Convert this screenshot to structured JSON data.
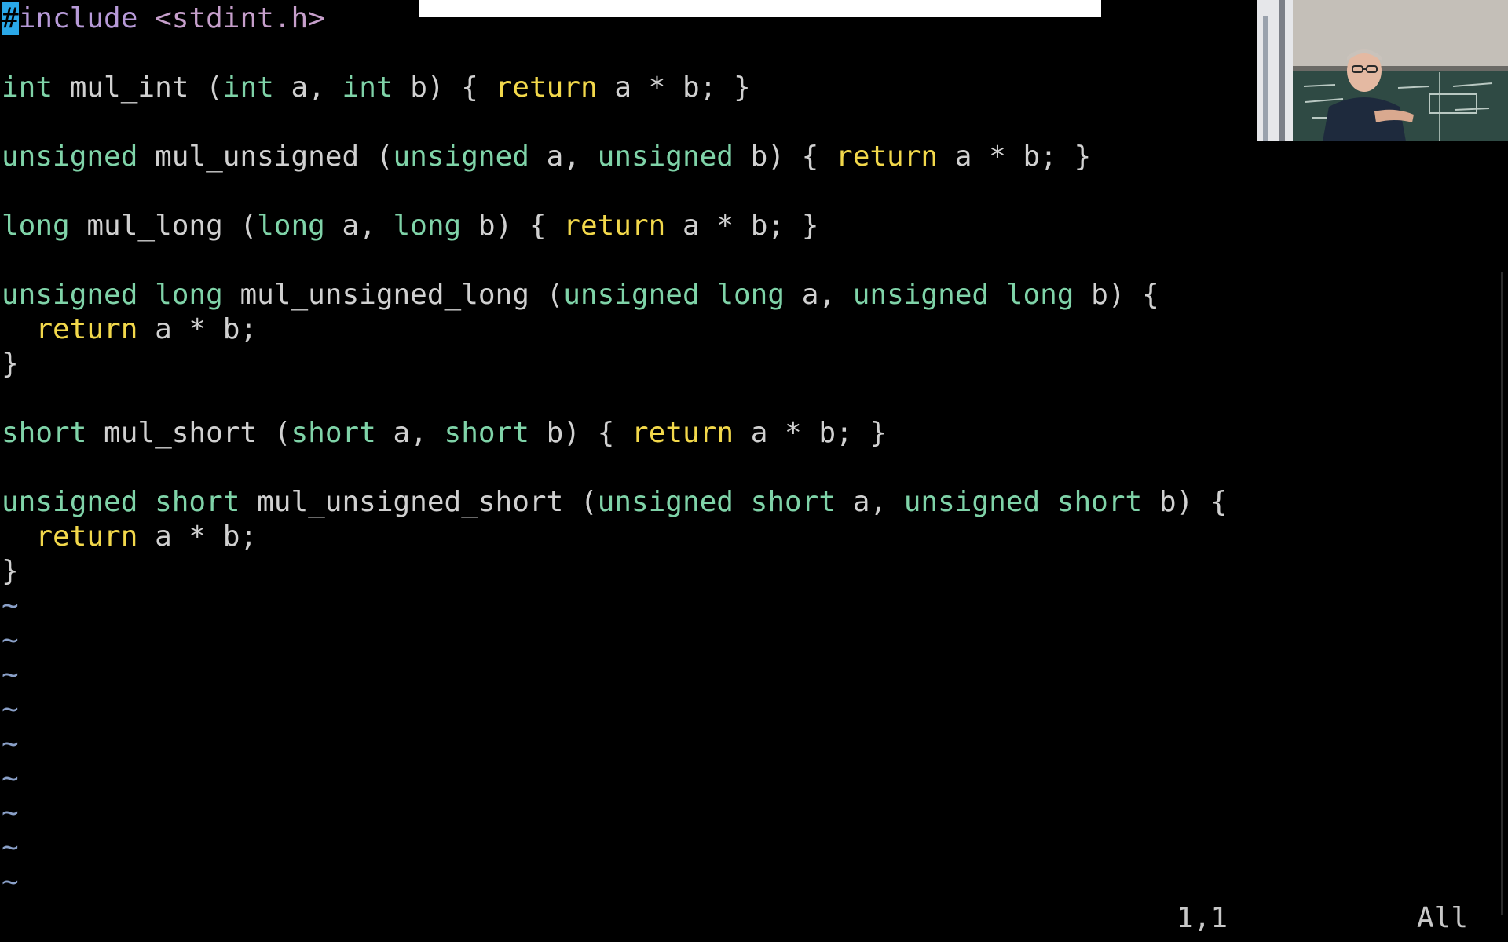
{
  "editor": {
    "lines": [
      [
        {
          "t": "#",
          "c": "cursor-char"
        },
        {
          "t": "include",
          "c": "kw-pre"
        },
        {
          "t": " ",
          "c": "plain"
        },
        {
          "t": "<stdint.h>",
          "c": "inc"
        }
      ],
      [],
      [
        {
          "t": "int",
          "c": "kw-type"
        },
        {
          "t": " mul_int (",
          "c": "plain"
        },
        {
          "t": "int",
          "c": "kw-type"
        },
        {
          "t": " a, ",
          "c": "plain"
        },
        {
          "t": "int",
          "c": "kw-type"
        },
        {
          "t": " b) { ",
          "c": "plain"
        },
        {
          "t": "return",
          "c": "kw-ret"
        },
        {
          "t": " a * b; }",
          "c": "plain"
        }
      ],
      [],
      [
        {
          "t": "unsigned",
          "c": "kw-type"
        },
        {
          "t": " mul_unsigned (",
          "c": "plain"
        },
        {
          "t": "unsigned",
          "c": "kw-type"
        },
        {
          "t": " a, ",
          "c": "plain"
        },
        {
          "t": "unsigned",
          "c": "kw-type"
        },
        {
          "t": " b) { ",
          "c": "plain"
        },
        {
          "t": "return",
          "c": "kw-ret"
        },
        {
          "t": " a * b; }",
          "c": "plain"
        }
      ],
      [],
      [
        {
          "t": "long",
          "c": "kw-type"
        },
        {
          "t": " mul_long (",
          "c": "plain"
        },
        {
          "t": "long",
          "c": "kw-type"
        },
        {
          "t": " a, ",
          "c": "plain"
        },
        {
          "t": "long",
          "c": "kw-type"
        },
        {
          "t": " b) { ",
          "c": "plain"
        },
        {
          "t": "return",
          "c": "kw-ret"
        },
        {
          "t": " a * b; }",
          "c": "plain"
        }
      ],
      [],
      [
        {
          "t": "unsigned long",
          "c": "kw-type"
        },
        {
          "t": " mul_unsigned_long (",
          "c": "plain"
        },
        {
          "t": "unsigned long",
          "c": "kw-type"
        },
        {
          "t": " a, ",
          "c": "plain"
        },
        {
          "t": "unsigned long",
          "c": "kw-type"
        },
        {
          "t": " b) {",
          "c": "plain"
        }
      ],
      [
        {
          "t": "  ",
          "c": "plain"
        },
        {
          "t": "return",
          "c": "kw-ret"
        },
        {
          "t": " a * b;",
          "c": "plain"
        }
      ],
      [
        {
          "t": "}",
          "c": "plain"
        }
      ],
      [],
      [
        {
          "t": "short",
          "c": "kw-type"
        },
        {
          "t": " mul_short (",
          "c": "plain"
        },
        {
          "t": "short",
          "c": "kw-type"
        },
        {
          "t": " a, ",
          "c": "plain"
        },
        {
          "t": "short",
          "c": "kw-type"
        },
        {
          "t": " b) { ",
          "c": "plain"
        },
        {
          "t": "return",
          "c": "kw-ret"
        },
        {
          "t": " a * b; }",
          "c": "plain"
        }
      ],
      [],
      [
        {
          "t": "unsigned short",
          "c": "kw-type"
        },
        {
          "t": " mul_unsigned_short (",
          "c": "plain"
        },
        {
          "t": "unsigned short",
          "c": "kw-type"
        },
        {
          "t": " a, ",
          "c": "plain"
        },
        {
          "t": "unsigned short",
          "c": "kw-type"
        },
        {
          "t": " b) {",
          "c": "plain"
        }
      ],
      [
        {
          "t": "  ",
          "c": "plain"
        },
        {
          "t": "return",
          "c": "kw-ret"
        },
        {
          "t": " a * b;",
          "c": "plain"
        }
      ],
      [
        {
          "t": "}",
          "c": "plain"
        }
      ],
      [
        {
          "t": "~",
          "c": "tilde"
        }
      ],
      [
        {
          "t": "~",
          "c": "tilde"
        }
      ],
      [
        {
          "t": "~",
          "c": "tilde"
        }
      ],
      [
        {
          "t": "~",
          "c": "tilde"
        }
      ],
      [
        {
          "t": "~",
          "c": "tilde"
        }
      ],
      [
        {
          "t": "~",
          "c": "tilde"
        }
      ],
      [
        {
          "t": "~",
          "c": "tilde"
        }
      ],
      [
        {
          "t": "~",
          "c": "tilde"
        }
      ],
      [
        {
          "t": "~",
          "c": "tilde"
        }
      ]
    ]
  },
  "status": {
    "position": "1,1",
    "scroll": "All"
  },
  "colors": {
    "background": "#000000",
    "type_keyword": "#7fd3a8",
    "return_keyword": "#f2d84b",
    "preprocessor": "#b79ad8",
    "include_path": "#c69fcb",
    "cursor": "#2aa8e8",
    "tilde": "#8aa0c8"
  },
  "webcam": {
    "icon": "presenter-webcam-icon"
  }
}
